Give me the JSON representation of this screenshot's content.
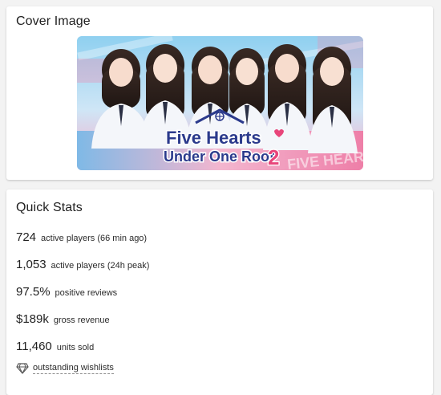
{
  "cover_card": {
    "title": "Cover Image",
    "image": {
      "logo_line1": "Five Hearts",
      "logo_line2": "Under One Roof",
      "logo_number": "2",
      "logo_color": "#2b3a8c",
      "accent_color": "#e8457a",
      "bg_top": "#8fd0f0",
      "bg_bottom": "#f6a9c8"
    }
  },
  "stats_card": {
    "title": "Quick Stats",
    "items": [
      {
        "value": "724",
        "label": "active players (66 min ago)"
      },
      {
        "value": "1,053",
        "label": "active players (24h peak)"
      },
      {
        "value": "97.5%",
        "label": "positive reviews"
      },
      {
        "value": "$189k",
        "label": "gross revenue"
      },
      {
        "value": "11,460",
        "label": "units sold"
      }
    ],
    "wishlist": {
      "icon": "diamond-icon",
      "label": "outstanding wishlists"
    }
  }
}
